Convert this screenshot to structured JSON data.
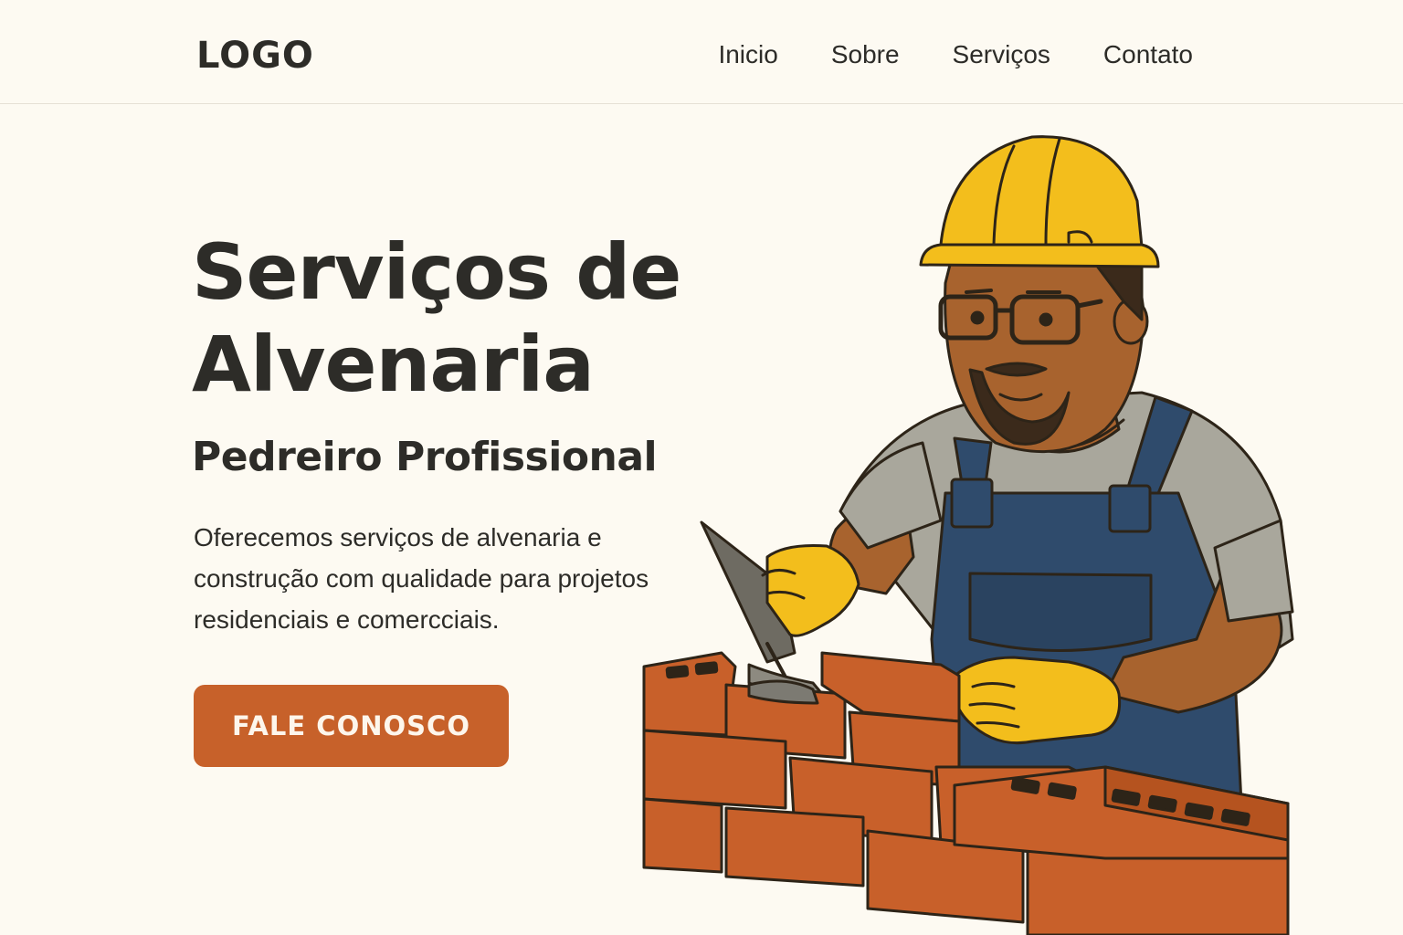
{
  "header": {
    "logo": "LOGO",
    "nav": [
      "Inicio",
      "Sobre",
      "Serviços",
      "Contato"
    ]
  },
  "hero": {
    "title_line1": "Serviços de",
    "title_line2": "Alvenaria",
    "subtitle": "Pedreiro Profissional",
    "description": "Oferecemos serviços de alvenaria e construção com qualidade para projetos residenciais e comercciais.",
    "cta_label": "FALE CONOSCO"
  },
  "illustration": {
    "subject": "bricklayer-with-trowel",
    "icon_names": [
      "hard-hat-icon",
      "glasses-icon",
      "trowel-icon",
      "brick-wall-icon"
    ]
  },
  "colors": {
    "background": "#fdfaf2",
    "text": "#2d2c28",
    "accent": "#c7612a",
    "helmet": "#f3be1c",
    "overalls": "#2f4b6c",
    "brick": "#c8602a"
  }
}
